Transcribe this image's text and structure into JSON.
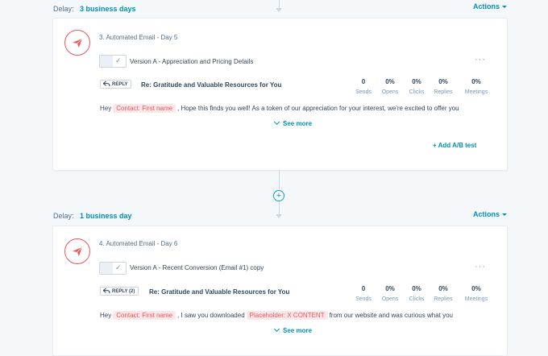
{
  "step1": {
    "delay_label": "Delay:",
    "delay_value": "3 business days",
    "actions": "Actions",
    "title": "3. Automated Email - Day 5",
    "version": "Version A - Appreciation and Pricing Details",
    "reply": "REPLY",
    "subject": "Re: Gratitude and Valuable Resources for You",
    "stats": [
      {
        "value": "0",
        "label": "Sends"
      },
      {
        "value": "0%",
        "label": "Opens"
      },
      {
        "value": "0%",
        "label": "Clicks"
      },
      {
        "value": "0%",
        "label": "Replies"
      },
      {
        "value": "0%",
        "label": "Meetings"
      }
    ],
    "body_prefix": "Hey",
    "token1": "Contact: First name",
    "body_suffix": ", Hope this finds you well! As a token of our appreciation for your interest, we're excited to offer you",
    "see_more": "See more",
    "add_ab": "+ Add A/B test"
  },
  "step2": {
    "delay_label": "Delay:",
    "delay_value": "1 business day",
    "actions": "Actions",
    "title": "4. Automated Email - Day 6",
    "version": "Version A - Recent Conversion (Email #1) copy",
    "reply": "REPLY (2)",
    "subject": "Re: Gratitude and Valuable Resources for You",
    "stats": [
      {
        "value": "0",
        "label": "Sends"
      },
      {
        "value": "0%",
        "label": "Opens"
      },
      {
        "value": "0%",
        "label": "Clicks"
      },
      {
        "value": "0%",
        "label": "Replies"
      },
      {
        "value": "0%",
        "label": "Meetings"
      }
    ],
    "body_prefix": "Hey",
    "token1": "Contact: First name",
    "body_middle": ", I saw you downloaded",
    "token2": "Placeholder: X CONTENT",
    "body_suffix": "from our website and was curious what you",
    "see_more": "See more"
  },
  "colors": {
    "accent": "#0091ae",
    "token_bg": "#fde8e9",
    "token_fg": "#f2545b",
    "icon": "#f2545b"
  },
  "icons": {
    "email": "paper-plane-icon",
    "reply": "reply-arrow-icon",
    "add": "plus-circle-icon",
    "more": "ellipsis-icon"
  }
}
